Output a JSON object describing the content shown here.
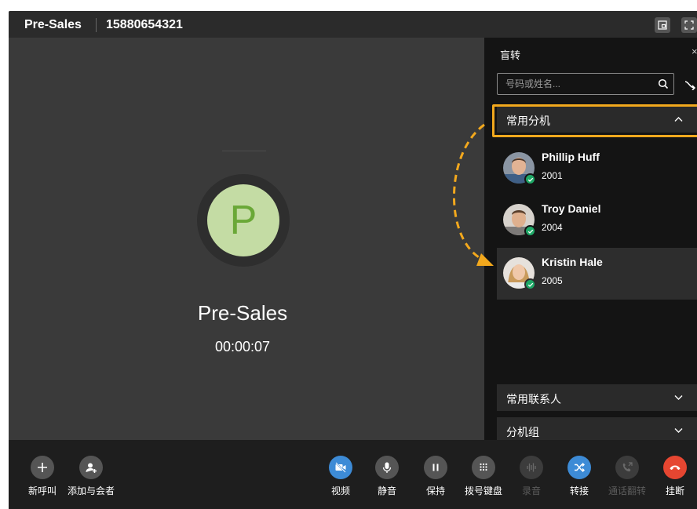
{
  "header": {
    "name": "Pre-Sales",
    "number": "15880654321"
  },
  "call": {
    "avatar_letter": "P",
    "name": "Pre-Sales",
    "timer": "00:00:07"
  },
  "transfer_panel": {
    "title": "盲转",
    "close": "×",
    "search_placeholder": "号码或姓名...",
    "groups": {
      "favorites": "常用分机",
      "contacts": "常用联系人",
      "ext_groups": "分机组"
    },
    "contacts": [
      {
        "name": "Phillip Huff",
        "ext": "2001"
      },
      {
        "name": "Troy Daniel",
        "ext": "2004"
      },
      {
        "name": "Kristin Hale",
        "ext": "2005"
      }
    ]
  },
  "toolbar": {
    "new_call": "新呼叫",
    "add_participant": "添加与会者",
    "video": "视频",
    "mute": "静音",
    "hold": "保持",
    "dialpad": "拨号键盘",
    "record": "录音",
    "transfer": "转接",
    "flip": "通话翻转",
    "hangup": "挂断"
  },
  "colors": {
    "highlight": "#f2a81d",
    "online": "#1ea866",
    "hangup": "#e64631",
    "transfer_active": "#3d8bd6",
    "video_active": "#3d8bd6",
    "avatar_bg": "#c4dca4",
    "avatar_text": "#6aa837"
  }
}
